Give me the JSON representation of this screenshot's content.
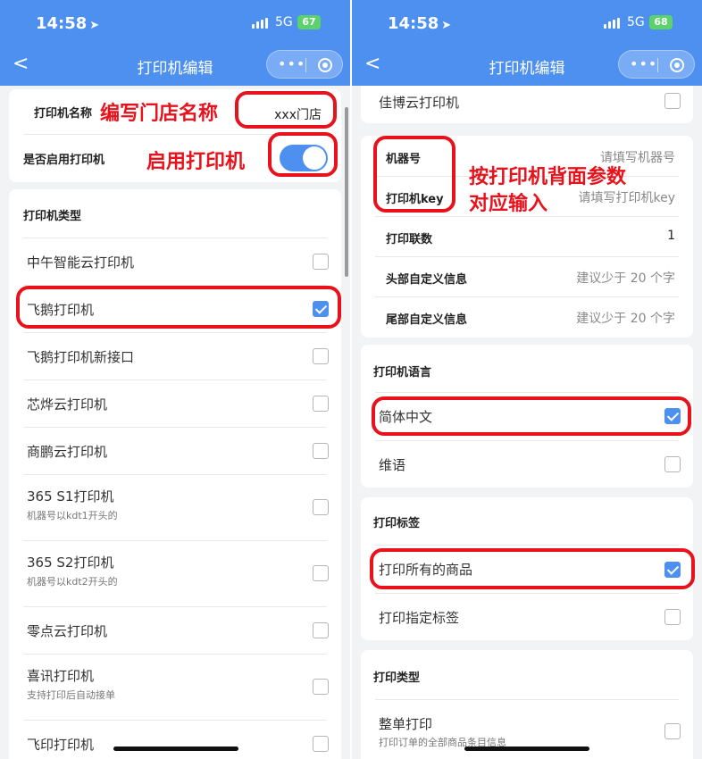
{
  "status_left": {
    "time": "14:58",
    "network": "5G",
    "battery": "67"
  },
  "status_right": {
    "time": "14:58",
    "network": "5G",
    "battery": "68"
  },
  "nav": {
    "title": "打印机编辑"
  },
  "left": {
    "name_label": "打印机名称",
    "name_value": "xxx门店",
    "enable_label": "是否启用打印机",
    "enable_on": true,
    "type_header": "打印机类型",
    "printers": [
      {
        "label": "中午智能云打印机",
        "sub": "",
        "checked": false
      },
      {
        "label": "飞鹅打印机",
        "sub": "",
        "checked": true
      },
      {
        "label": "飞鹅打印机新接口",
        "sub": "",
        "checked": false
      },
      {
        "label": "芯烨云打印机",
        "sub": "",
        "checked": false
      },
      {
        "label": "商鹏云打印机",
        "sub": "",
        "checked": false
      },
      {
        "label": "365 S1打印机",
        "sub": "机器号以kdt1开头的",
        "checked": false
      },
      {
        "label": "365 S2打印机",
        "sub": "机器号以kdt2开头的",
        "checked": false
      },
      {
        "label": "零点云打印机",
        "sub": "",
        "checked": false
      },
      {
        "label": "喜讯打印机",
        "sub": "支持打印后自动接单",
        "checked": false
      },
      {
        "label": "飞印打印机",
        "sub": "",
        "checked": false
      }
    ],
    "annotations": {
      "name": "编写门店名称",
      "enable": "启用打印机"
    }
  },
  "right": {
    "top_printer": {
      "label": "佳博云打印机",
      "checked": false
    },
    "machine_no_label": "机器号",
    "machine_no_placeholder": "请填写机器号",
    "key_label": "打印机key",
    "key_placeholder": "请填写打印机key",
    "copies_label": "打印联数",
    "copies_value": "1",
    "header_info_label": "头部自定义信息",
    "header_info_placeholder": "建议少于 20 个字",
    "footer_info_label": "尾部自定义信息",
    "footer_info_placeholder": "建议少于 20 个字",
    "language_header": "打印机语言",
    "languages": [
      {
        "label": "简体中文",
        "checked": true
      },
      {
        "label": "维语",
        "checked": false
      }
    ],
    "label_header": "打印标签",
    "labels": [
      {
        "label": "打印所有的商品",
        "checked": true
      },
      {
        "label": "打印指定标签",
        "checked": false
      }
    ],
    "print_type_header": "打印类型",
    "print_types": [
      {
        "label": "整单打印",
        "sub": "打印订单的全部商品条目信息",
        "checked": false
      }
    ],
    "annotation_line1": "按打印机背面参数",
    "annotation_line2": "对应输入"
  },
  "colors": {
    "nav_blue": "#4d90f0",
    "highlight_red": "#e8121c",
    "checkbox_blue": "#4d90f0"
  }
}
